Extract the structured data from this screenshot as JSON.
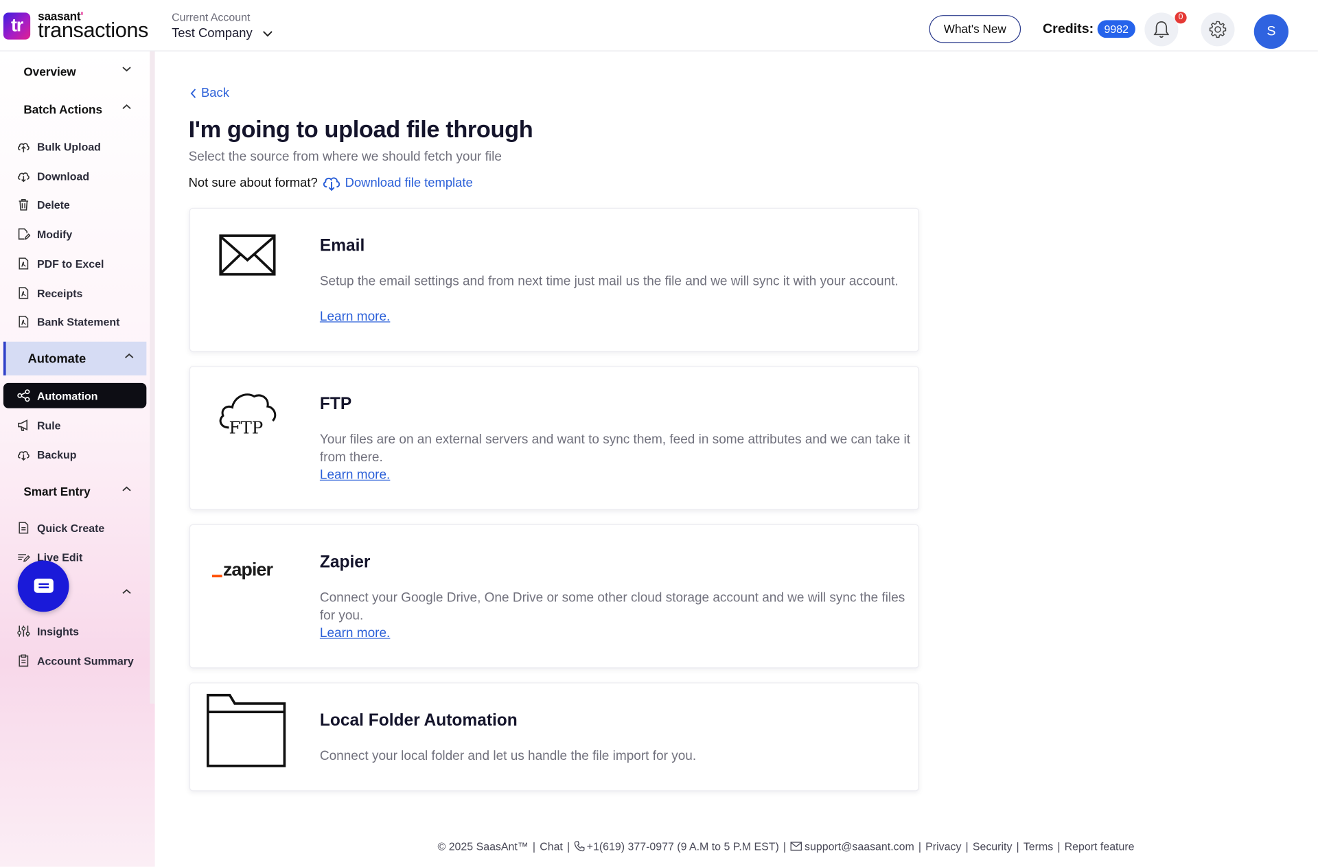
{
  "header": {
    "logo_small": "saasant",
    "logo_big": "transactions",
    "account_label": "Current Account",
    "account_name": "Test Company",
    "whats_new": "What's New",
    "credits_label": "Credits:",
    "credits_value": "9982",
    "notification_count": "0",
    "avatar_initial": "S"
  },
  "sidebar": {
    "groups": {
      "overview": "Overview",
      "batch_actions": "Batch Actions",
      "automate": "Automate",
      "smart_entry": "Smart Entry"
    },
    "items": {
      "bulk_upload": "Bulk Upload",
      "download": "Download",
      "delete": "Delete",
      "modify": "Modify",
      "pdf_to_excel": "PDF to Excel",
      "receipts": "Receipts",
      "bank_statement": "Bank Statement",
      "automation": "Automation",
      "rule": "Rule",
      "backup": "Backup",
      "quick_create": "Quick Create",
      "live_edit": "Live Edit",
      "insights": "Insights",
      "account_summary": "Account Summary"
    },
    "selected": "Automation"
  },
  "main": {
    "back": "Back",
    "title": "I'm going to upload file through",
    "subtitle": "Select the source from where we should fetch your file",
    "format_question": "Not sure about format?",
    "template_link": "Download file template",
    "cards": [
      {
        "title": "Email",
        "icon": "envelope-icon",
        "desc": "Setup the email settings and from next time just mail us the file and we will sync it with your account.",
        "link": "Learn more."
      },
      {
        "title": "FTP",
        "icon": "ftp-cloud-icon",
        "icon_text": "FTP",
        "desc": "Your files are on an external servers and want to sync them, feed in some attributes and we can take it from there.",
        "link": "Learn more."
      },
      {
        "title": "Zapier",
        "icon": "zapier-logo",
        "icon_text": "zapier",
        "desc": "Connect your Google Drive, One Drive or some other cloud storage account and we will sync the files for you.",
        "link": "Learn more."
      },
      {
        "title": "Local Folder Automation",
        "icon": "folder-icon",
        "desc": "Connect your local folder and let us handle the file import for you."
      }
    ]
  },
  "footer": {
    "copyright": "© 2025 SaasAnt™",
    "chat": "Chat",
    "phone": "+1(619) 377-0977 (9 A.M to 5 P.M EST)",
    "email": "support@saasant.com",
    "privacy": "Privacy",
    "security": "Security",
    "terms": "Terms",
    "report": "Report feature"
  },
  "colors": {
    "accent": "#2a5fd8",
    "credits_badge": "#2563eb",
    "chat_button": "#1a1ad9",
    "notification": "#e53935",
    "zapier_orange": "#ff4f00"
  }
}
